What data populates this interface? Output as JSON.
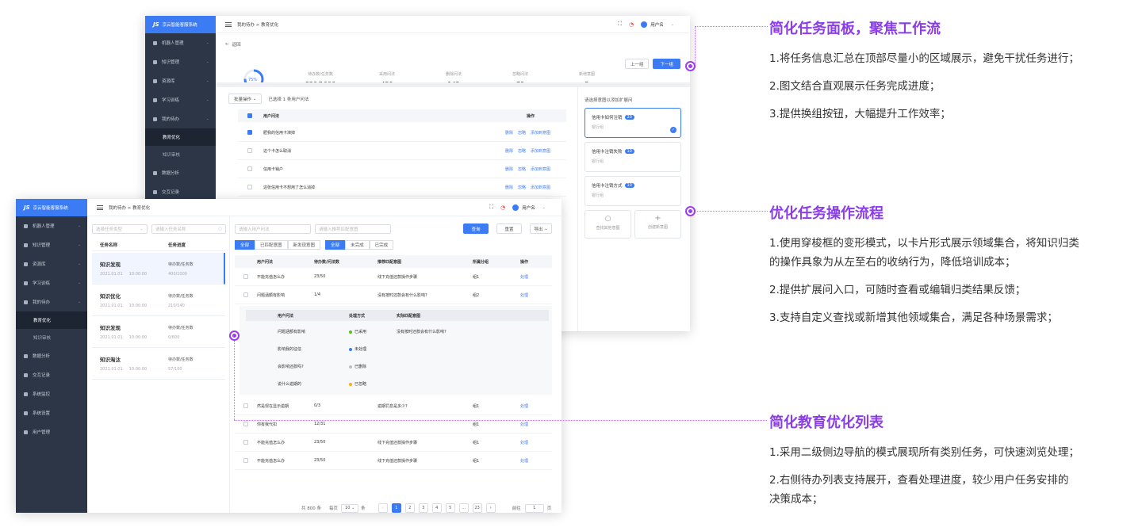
{
  "app": {
    "brand": "京云智能客服系统"
  },
  "sidebar_top": {
    "items": [
      "机器人管理",
      "知识管理",
      "资源库",
      "学习训练",
      "我的待办",
      "数据分析",
      "交互记录"
    ],
    "subitems": [
      "教育优化",
      "知识审核"
    ]
  },
  "sidebar_front": {
    "items": [
      "机器人管理",
      "知识管理",
      "资源库",
      "学习训练",
      "我的待办",
      "数据分析",
      "交互记录",
      "系统监控",
      "系统设置",
      "用户管理"
    ],
    "subitems": [
      "教育优化",
      "知识审核"
    ]
  },
  "header": {
    "breadcrumb": "我的待办 > 教育优化",
    "username": "用户名"
  },
  "top_screen": {
    "back": "返回",
    "prev": "上一组",
    "next": "下一组",
    "progress": "75%",
    "stats": [
      {
        "label": "待办数/任务数",
        "value": "320/1000"
      },
      {
        "label": "采用问法",
        "value": "459"
      },
      {
        "label": "删除问法",
        "value": "142"
      },
      {
        "label": "忽略问法",
        "value": "79"
      },
      {
        "label": "新增意图",
        "value": "5"
      }
    ],
    "batch": "批量操作",
    "selected": "已选择 1 条用户问法",
    "col_question": "用户问法",
    "col_action": "操作",
    "rows": [
      "肥我的信用卡演掉",
      "这个卡怎么取消",
      "信用卡销户",
      "这张信用卡不想用了怎么消掉"
    ],
    "actions": [
      "删除",
      "忽略",
      "添加到意图"
    ],
    "panel_title": "请选择意图以添加扩展问",
    "cards": [
      {
        "title": "信用卡如何注销",
        "badge": "20",
        "sub": "银行组"
      },
      {
        "title": "信用卡注销失败",
        "badge": "10",
        "sub": "银行组"
      },
      {
        "title": "信用卡注销方式",
        "badge": "10",
        "sub": "银行组"
      }
    ],
    "find_other": "查找其他意图",
    "create_new": "创建新意图"
  },
  "front_screen": {
    "filter_type": "选择任务类型",
    "filter_name": "请输入任务名称",
    "col_task": "任务名称",
    "col_progress": "任务进度",
    "tasks": [
      {
        "name": "知识发现",
        "date": "2021.01.01",
        "time": "10:00:00",
        "plabel": "待办数/任务数",
        "pval": "400/1000"
      },
      {
        "name": "知识优化",
        "date": "2021.01.01",
        "time": "10:00:00",
        "plabel": "待办数/任务数",
        "pval": "210/540"
      },
      {
        "name": "知识发现",
        "date": "2021.01.01",
        "time": "10:00:00",
        "plabel": "待办数/任务数",
        "pval": "0/600"
      },
      {
        "name": "知识淘汰",
        "date": "2021.01.01",
        "time": "10:00:00",
        "plabel": "待办数/任务数",
        "pval": "57/100"
      }
    ],
    "input_question": "请输入用户问法",
    "input_intent": "请输入推荐匹配意图",
    "query": "查询",
    "reset": "重置",
    "export": "导出",
    "tabs_a": [
      "全部",
      "已匹配意图",
      "新发现意图"
    ],
    "tabs_b": [
      "全部",
      "未完成",
      "已完成"
    ],
    "cols": [
      "用户问法",
      "待办数/问法数",
      "推荐匹配意图",
      "所属分组",
      "操作"
    ],
    "rows": [
      {
        "q": "不能充值怎么办",
        "n": "23/50",
        "i": "线下充值还款操作步骤",
        "g": "组1",
        "a": "处理"
      },
      {
        "q": "问题涵额有影响",
        "n": "1/4",
        "i": "没有按时还款会有什么影响?",
        "g": "组2",
        "a": "处理"
      }
    ],
    "sub_cols": [
      "用户问法",
      "处理方式",
      "实际匹配意图"
    ],
    "sub_rows": [
      {
        "q": "问题涵额有影响",
        "s": "已采用",
        "c": "#52c41a",
        "i": "没有按时还款会有什么影响?"
      },
      {
        "q": "影响我的征信",
        "s": "未处理",
        "c": "#3b7cf5",
        "i": ""
      },
      {
        "q": "会影响还款吗?",
        "s": "已删除",
        "c": "#bfbfbf",
        "i": ""
      },
      {
        "q": "说什么逾期的",
        "s": "已忽略",
        "c": "#faad14",
        "i": ""
      }
    ],
    "rows2": [
      {
        "q": "然是现在显示逾期",
        "n": "0/3",
        "i": "逾期罚息是多少?",
        "g": "组1",
        "a": "处理"
      },
      {
        "q": "你有我代扣",
        "n": "12/31",
        "i": "",
        "g": "组1",
        "a": "处理"
      },
      {
        "q": "不能充值怎么办",
        "n": "23/50",
        "i": "线下充值还款操作步骤",
        "g": "组1",
        "a": "处理"
      },
      {
        "q": "不能充值怎么办",
        "n": "23/50",
        "i": "线下充值还款操作步骤",
        "g": "组1",
        "a": "处理"
      }
    ],
    "pagination": {
      "total": "共 800 条",
      "perpage": "每页",
      "size": "10",
      "unit": "条",
      "pages": [
        "1",
        "2",
        "3",
        "4",
        "5",
        "...",
        "23"
      ],
      "goto": "前往",
      "goto_val": "1",
      "page_unit": "页"
    }
  },
  "annotations": [
    {
      "title": "简化任务面板，聚焦工作流",
      "lines": [
        "1.将任务信息汇总在顶部尽量小的区域展示，避免干扰任务进行；",
        "2.图文结合直观展示任务完成进度；",
        "3.提供换组按钮，大幅提升工作效率；"
      ]
    },
    {
      "title": "优化任务操作流程",
      "lines": [
        "1.使用穿梭框的变形模式，以卡片形式展示领域集合，将知识归类",
        "的操作具象为从左至右的收纳行为，降低培训成本；",
        "2.提供扩展问入口，可随时查看或编辑归类结果反馈；",
        "3.支持自定义查找或新增其他领域集合，满足各种场景需求；"
      ]
    },
    {
      "title": "简化教育优化列表",
      "lines": [
        "1.采用二级侧边导航的模式展现所有类别任务，可快速浏览处理；",
        "2.右侧待办列表支持展开，查看处理进度，较少用户任务安排的",
        "决策成本；"
      ]
    }
  ]
}
